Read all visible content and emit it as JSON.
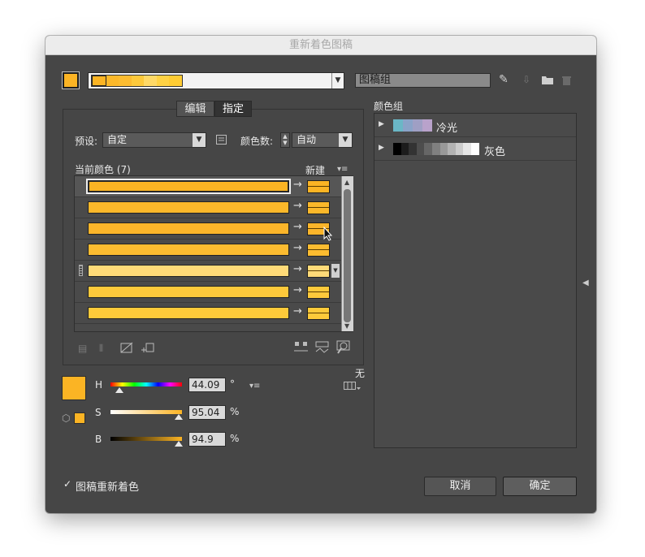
{
  "window": {
    "title": "重新着色图稿"
  },
  "top": {
    "harmony_name": "图稿组",
    "colors": {
      "accent": "#fbb424",
      "light": "#ffd966",
      "highlight": "#ffcb33"
    }
  },
  "tabs": [
    {
      "label": "编辑"
    },
    {
      "label": "指定"
    }
  ],
  "preset": {
    "label": "预设:",
    "value": "自定"
  },
  "color_count": {
    "label": "颜色数:",
    "value": "自动"
  },
  "list": {
    "current_header": "当前颜色 (7)",
    "new_header": "新建",
    "rows": [
      {
        "color": "#fbb424"
      },
      {
        "color": "#fbb82a"
      },
      {
        "color": "#fbb52a"
      },
      {
        "color": "#fcbc30"
      },
      {
        "color": "#ffda78"
      },
      {
        "color": "#fdc93b"
      },
      {
        "color": "#fdca3a"
      }
    ]
  },
  "none_label": "无",
  "hsb": {
    "h": {
      "label": "H",
      "value": "44.09",
      "unit": "°",
      "fraction": 0.12
    },
    "s": {
      "label": "S",
      "value": "95.04",
      "unit": "%",
      "fraction": 0.95
    },
    "b": {
      "label": "B",
      "value": "94.9",
      "unit": "%",
      "fraction": 0.95
    }
  },
  "color_groups": {
    "title": "颜色组",
    "items": [
      {
        "name": "冷光",
        "colors": [
          "#6ab7c6",
          "#8aa3c8",
          "#9f9fc4",
          "#b9a2cb"
        ]
      },
      {
        "name": "灰色",
        "colors": [
          "#000000",
          "#1c1c1c",
          "#333333",
          "#4d4d4d",
          "#666666",
          "#808080",
          "#999999",
          "#b3b3b3",
          "#cccccc",
          "#e6e6e6",
          "#ffffff"
        ]
      }
    ]
  },
  "recolor_checkbox": {
    "label": "图稿重新着色",
    "checked": true
  },
  "buttons": {
    "cancel": "取消",
    "ok": "确定"
  }
}
